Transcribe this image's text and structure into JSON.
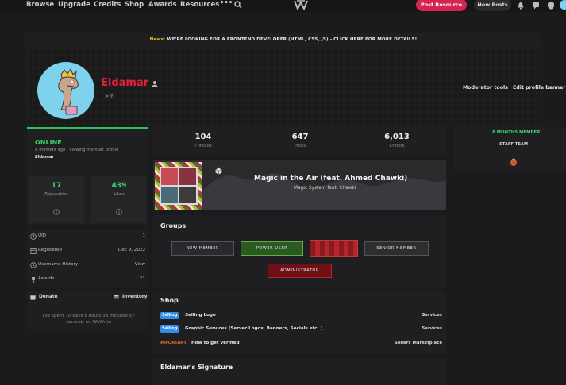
{
  "nav": {
    "items": [
      "Browse",
      "Upgrade",
      "Credits",
      "Shop",
      "Awards",
      "Resources"
    ],
    "post_resource": "Post Resource",
    "new_posts": "New Posts"
  },
  "news": {
    "label": "News:",
    "text": "WE'RE LOOKING FOR A FRONTEND DEVELOPER (HTML, CSS, JS) - CLICK HERE FOR MORE DETAILS!"
  },
  "profile": {
    "username": "Eldamar",
    "user_title": ">:Y",
    "moderator_tools": "Moderator tools",
    "edit_banner": "Edit profile banner"
  },
  "status": {
    "state": "ONLINE",
    "activity": "A moment ago · Viewing member profile",
    "activity_user": "Eldamar",
    "reputation_value": "17",
    "reputation_label": "Reputation",
    "likes_value": "439",
    "likes_label": "Likes"
  },
  "info": {
    "rows": [
      {
        "label": "UID",
        "value": "1"
      },
      {
        "label": "Registered",
        "value": "Dec 9, 2022"
      },
      {
        "label": "Username History",
        "value": "View"
      },
      {
        "label": "Awards",
        "value": "21"
      }
    ]
  },
  "actions": {
    "donate": "Donate",
    "inventory": "Inventory",
    "time_spent": "I've spent 10 days 6 hours 38 minutes 57 seconds on WeWrite"
  },
  "stats": {
    "threads_value": "104",
    "threads_label": "Threads",
    "posts_value": "647",
    "posts_label": "Posts",
    "credits_value": "6,013",
    "credits_label": "Credits"
  },
  "music": {
    "title": "Magic in the Air (feat. Ahmed Chawki)",
    "artist": "Magic System feat. Chawki"
  },
  "groups": {
    "title": "Groups",
    "badges": [
      "NEW MEMBER",
      "POWER USER",
      "",
      "SENIOR MEMBER",
      "ADMINISTRATOR"
    ],
    "colors": {
      "new": "#2a2a2e",
      "power": "#2a5a1f",
      "red": "#8b1a1f",
      "senior": "#2e2e31",
      "admin": "#6e1016"
    }
  },
  "shop": {
    "title": "Shop",
    "tag": "Selling",
    "items": [
      {
        "name": "Selling Logo",
        "category": "Services"
      },
      {
        "name": "Graphic Services (Server Logos, Banners, Socials etc..)",
        "category": "Services"
      }
    ],
    "important_label": "IMPORTANT",
    "important_name": "How to get verified",
    "important_category": "Sellers Marketplace"
  },
  "signature": {
    "title": "Eldamar's Signature"
  },
  "member": {
    "months": "8 MONTHS MEMBER",
    "team": "STAFF TEAM"
  },
  "colors": {
    "accent_red": "#e5213a",
    "online_green": "#3bd16d",
    "button_pink": "#d62452",
    "tag_blue": "#2f8ee6"
  }
}
